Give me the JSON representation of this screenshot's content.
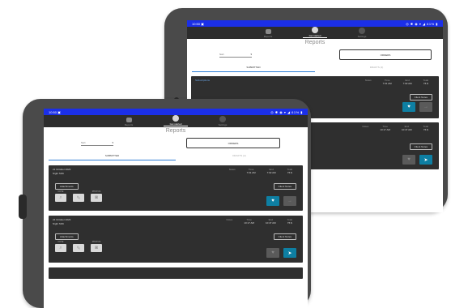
{
  "status": {
    "time": "10:50",
    "sim_icon": "▣",
    "right_icons": "◎ ✱ ◉ ▾ ◢ 61% ▮"
  },
  "nav": {
    "items": [
      {
        "label": "Reports",
        "icon": "clipboard-icon"
      },
      {
        "label": "Get started",
        "icon": "globe-icon"
      },
      {
        "label": "Settings",
        "icon": "gear-icon"
      }
    ]
  },
  "page": {
    "title": "Reports"
  },
  "controls": {
    "dropdown_value": "Sort",
    "action_button": "ORDERS"
  },
  "tabs": {
    "submitted": "SUBMITTED",
    "draft": "DRAFTS (2)"
  },
  "back_tablet": {
    "cards": [
      {
        "title_label": "Subscriptions",
        "line1": "",
        "line2": "",
        "status_col_header": "Notes",
        "cols": [
          {
            "header": "Time",
            "value": "7:01 AM"
          },
          {
            "header": "End",
            "value": "7:02 AM"
          },
          {
            "header": "Total",
            "value": "76 $"
          }
        ],
        "client_button": "Client Notes",
        "buttons": [
          {
            "name": "heart",
            "symbol": "♥",
            "style": "teal"
          },
          {
            "name": "send",
            "symbol": "→",
            "style": "grey"
          }
        ]
      },
      {
        "title_label": "",
        "line1": "",
        "line2": "",
        "status_col_header": "Notes",
        "cols": [
          {
            "header": "Time",
            "value": "10:17 AM"
          },
          {
            "header": "End",
            "value": "10:47 AM"
          },
          {
            "header": "Total",
            "value": "76 $"
          }
        ],
        "client_button": "Client Notes",
        "buttons": [
          {
            "name": "heart",
            "symbol": "♥",
            "style": "grey"
          },
          {
            "name": "send",
            "symbol": "➤",
            "style": "teal"
          }
        ]
      }
    ]
  },
  "front_tablet": {
    "cards": [
      {
        "title_label": "",
        "line1": "21 October 2023",
        "line2": "Night Shift",
        "status_col_header": "Notes",
        "cols": [
          {
            "header": "Time",
            "value": "7:01 AM"
          },
          {
            "header": "End",
            "value": "7:02 AM"
          },
          {
            "header": "Total",
            "value": "76 $"
          }
        ],
        "attach_button": "Attachments",
        "client_button": "Client Notes",
        "tools": [
          {
            "label": "NOTE",
            "icon": "search-icon",
            "symbol": "⌕"
          },
          {
            "label": "",
            "icon": "pencil-icon",
            "symbol": "✎"
          },
          {
            "label": "PHOTOS",
            "icon": "camera-icon",
            "symbol": "◙"
          }
        ],
        "buttons": [
          {
            "name": "heart",
            "symbol": "♥",
            "style": "teal"
          },
          {
            "name": "send",
            "symbol": "→",
            "style": "grey"
          }
        ]
      },
      {
        "title_label": "",
        "line1": "24 October 2023",
        "line2": "Night Shift",
        "status_col_header": "Notes",
        "cols": [
          {
            "header": "Time",
            "value": "10:17 AM"
          },
          {
            "header": "End",
            "value": "10:47 AM"
          },
          {
            "header": "Total",
            "value": "76 $"
          }
        ],
        "attach_button": "Attachments",
        "client_button": "Client Notes",
        "tools": [
          {
            "label": "NOTE",
            "icon": "search-icon",
            "symbol": "⌕"
          },
          {
            "label": "",
            "icon": "pencil-icon",
            "symbol": "✎"
          },
          {
            "label": "PHOTOS",
            "icon": "camera-icon",
            "symbol": "◙"
          }
        ],
        "buttons": [
          {
            "name": "heart",
            "symbol": "♥",
            "style": "grey"
          },
          {
            "name": "send",
            "symbol": "➤",
            "style": "teal"
          }
        ]
      }
    ]
  },
  "colors": {
    "status_bar": "#1b2fe8",
    "nav_bar": "#2d2d2d",
    "card": "#2f2f2f",
    "accent_teal": "#0e7fa3",
    "tab_underline": "#2f7fd6",
    "device": "#4a4a4a"
  }
}
